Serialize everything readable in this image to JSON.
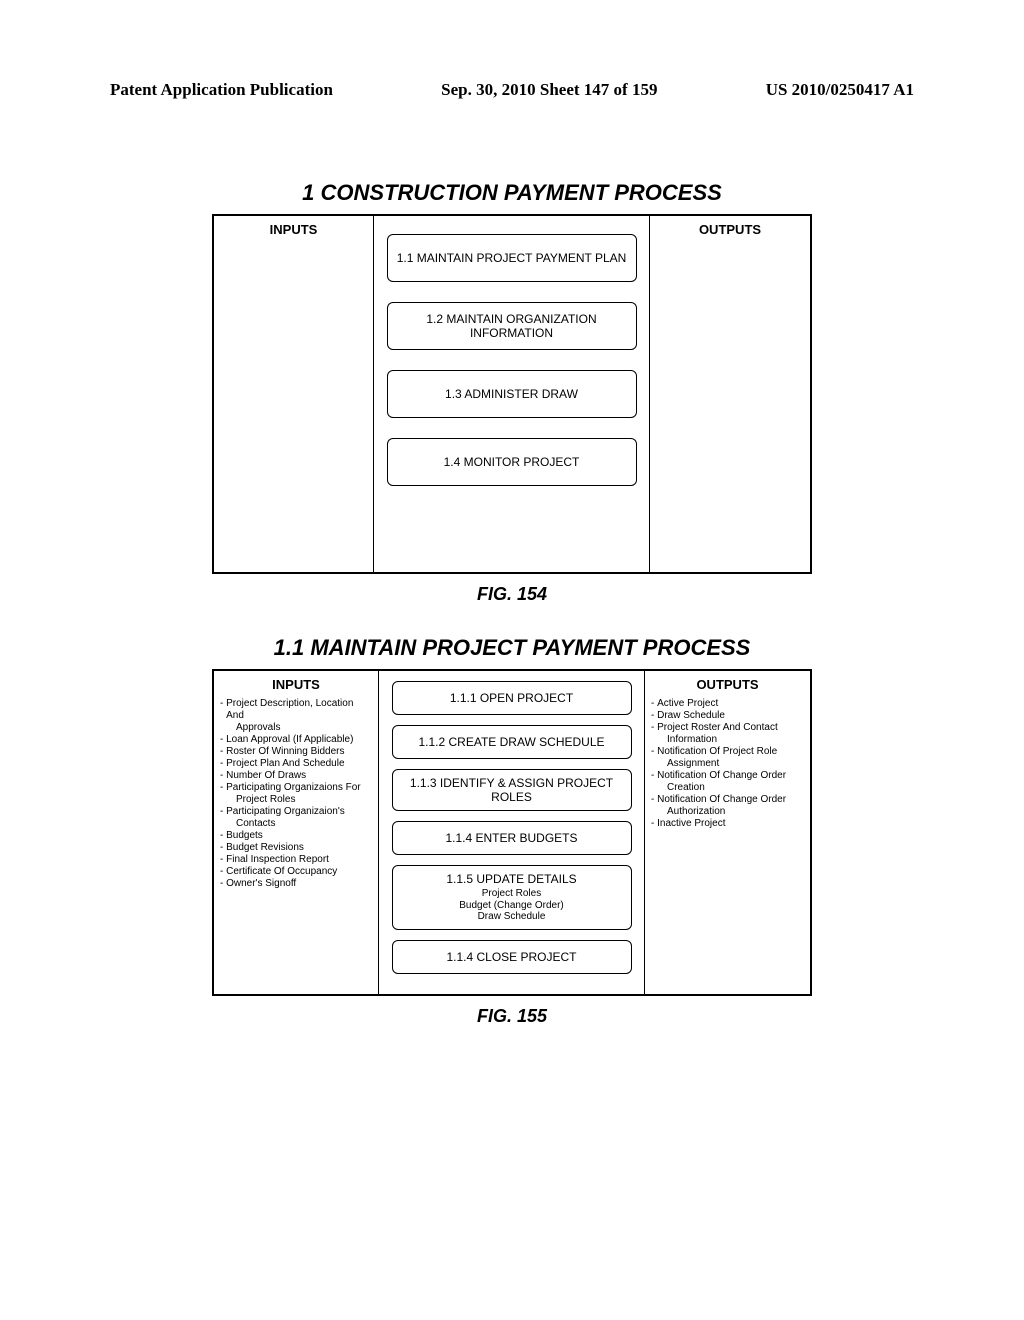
{
  "header": {
    "left": "Patent Application Publication",
    "center": "Sep. 30, 2010  Sheet 147 of 159",
    "right": "US 2010/0250417 A1"
  },
  "fig154": {
    "title": "1 CONSTRUCTION PAYMENT PROCESS",
    "inputs_header": "INPUTS",
    "outputs_header": "OUTPUTS",
    "processes": [
      "1.1 MAINTAIN PROJECT PAYMENT PLAN",
      "1.2 MAINTAIN ORGANIZATION INFORMATION",
      "1.3 ADMINISTER DRAW",
      "1.4 MONITOR PROJECT"
    ],
    "caption": "FIG. 154"
  },
  "fig155": {
    "title": "1.1 MAINTAIN PROJECT PAYMENT PROCESS",
    "inputs_header": "INPUTS",
    "outputs_header": "OUTPUTS",
    "inputs": [
      {
        "text": "Project Description, Location And",
        "indent": false
      },
      {
        "text": "Approvals",
        "indent": true,
        "nobullet": true
      },
      {
        "text": "Loan Approval (If Applicable)",
        "indent": false
      },
      {
        "text": "Roster Of Winning Bidders",
        "indent": false
      },
      {
        "text": "Project Plan And Schedule",
        "indent": false
      },
      {
        "text": "Number Of Draws",
        "indent": false
      },
      {
        "text": "Participating Organizaions For",
        "indent": false
      },
      {
        "text": "Project Roles",
        "indent": true,
        "nobullet": true
      },
      {
        "text": "Participating Organizaion's",
        "indent": false
      },
      {
        "text": "Contacts",
        "indent": true,
        "nobullet": true
      },
      {
        "text": "Budgets",
        "indent": false
      },
      {
        "text": "Budget Revisions",
        "indent": false
      },
      {
        "text": "Final Inspection Report",
        "indent": false
      },
      {
        "text": "Certificate Of Occupancy",
        "indent": false
      },
      {
        "text": "Owner's Signoff",
        "indent": false
      }
    ],
    "outputs": [
      {
        "text": "Active Project",
        "indent": false
      },
      {
        "text": "Draw Schedule",
        "indent": false
      },
      {
        "text": "Project Roster And Contact",
        "indent": false
      },
      {
        "text": "Information",
        "indent": true,
        "nobullet": true
      },
      {
        "text": "Notification Of Project Role",
        "indent": false
      },
      {
        "text": "Assignment",
        "indent": true,
        "nobullet": true
      },
      {
        "text": "Notification Of Change Order",
        "indent": false
      },
      {
        "text": "Creation",
        "indent": true,
        "nobullet": true
      },
      {
        "text": "Notification Of Change Order",
        "indent": false
      },
      {
        "text": "Authorization",
        "indent": true,
        "nobullet": true
      },
      {
        "text": "Inactive Project",
        "indent": false
      }
    ],
    "processes": [
      {
        "title": "1.1.1 OPEN PROJECT",
        "sub": []
      },
      {
        "title": "1.1.2 CREATE DRAW SCHEDULE",
        "sub": []
      },
      {
        "title": "1.1.3 IDENTIFY & ASSIGN PROJECT ROLES",
        "sub": []
      },
      {
        "title": "1.1.4 ENTER BUDGETS",
        "sub": []
      },
      {
        "title": "1.1.5 UPDATE DETAILS",
        "sub": [
          "Project Roles",
          "Budget (Change Order)",
          "Draw Schedule"
        ]
      },
      {
        "title": "1.1.4 CLOSE PROJECT",
        "sub": []
      }
    ],
    "caption": "FIG. 155"
  }
}
